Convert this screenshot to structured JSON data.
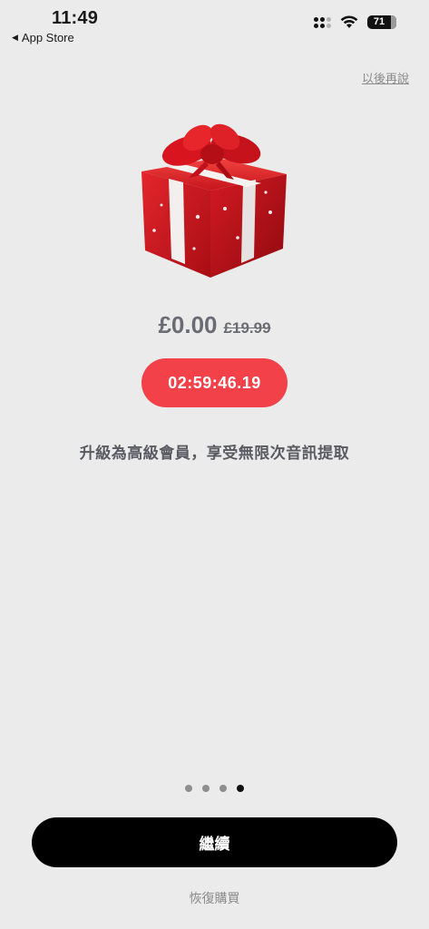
{
  "status_bar": {
    "time": "11:49",
    "back_label": "App Store",
    "battery": "71"
  },
  "header": {
    "later_label": "以後再說"
  },
  "offer": {
    "price_now": "£0.00",
    "price_old": "£19.99",
    "timer": "02:59:46.19",
    "description": "升級為高級會員，享受無限次音訊提取",
    "image_icon": "gift-box-icon"
  },
  "pager": {
    "count": 4,
    "active_index": 3
  },
  "actions": {
    "continue_label": "繼續",
    "restore_label": "恢復購買"
  },
  "colors": {
    "background": "#ebebeb",
    "timer_bg": "#f24149",
    "button_bg": "#000000",
    "gift_red": "#d81e26"
  }
}
